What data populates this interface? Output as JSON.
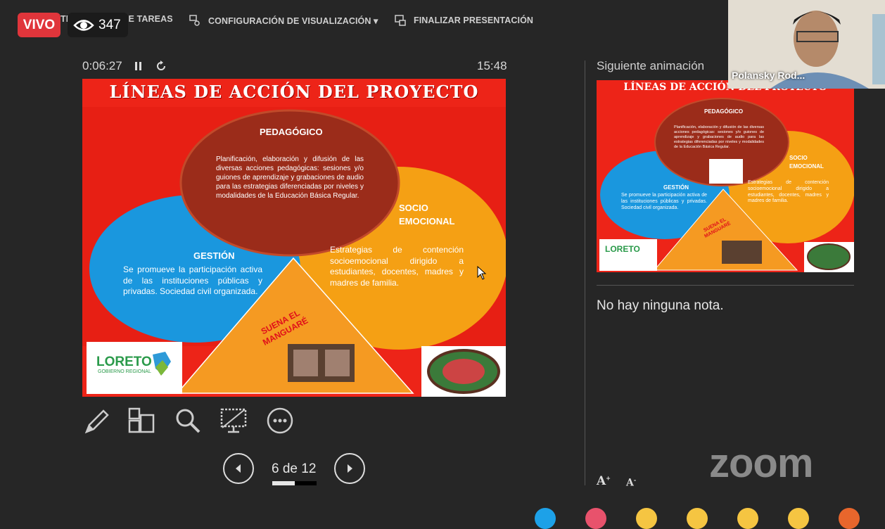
{
  "toolbar": {
    "taskbar_label": "TRAR BARRA DE TAREAS",
    "display_settings_label": "CONFIGURACIÓN DE VISUALIZACIÓN ▾",
    "end_show_label": "FINALIZAR PRESENTACIÓN"
  },
  "live": {
    "badge": "VIVO",
    "viewers": "347"
  },
  "presenter": {
    "elapsed": "0:06:27",
    "clock": "15:48"
  },
  "slide": {
    "title": "LÍNEAS DE ACCIÓN DEL PROYECTO",
    "pedagogico_title": "PEDAGÓGICO",
    "pedagogico_text": "Planificación, elaboración y difusión de las diversas acciones pedagógicas: sesiones y/o guiones de aprendizaje y grabaciones de audio para las estrategias diferenciadas por niveles y modalidades de la Educación Básica Regular.",
    "gestion_title": "GESTIÓN",
    "gestion_text": "Se promueve la participación activa de las instituciones públicas y privadas. Sociedad civil organizada.",
    "socio_title_1": "SOCIO",
    "socio_title_2": "EMOCIONAL",
    "socio_text": "Estrategias de contención socioemocional dirigido a estudiantes, docentes, madres y madres de familia.",
    "suena_1": "SUENA EL",
    "suena_2": "MANGUARÉ",
    "logo_text": "LORETO",
    "logo_sub": "GOBIERNO REGIONAL"
  },
  "pager": {
    "label": "6 de 12",
    "progress": 0.5
  },
  "next_panel": {
    "label": "Siguiente animación"
  },
  "notes": {
    "text": "No hay ninguna nota."
  },
  "video": {
    "name": "Polansky Rod..."
  },
  "brand": {
    "zoom": "zoom"
  },
  "font_controls": {
    "increase": "A",
    "decrease": "A"
  }
}
